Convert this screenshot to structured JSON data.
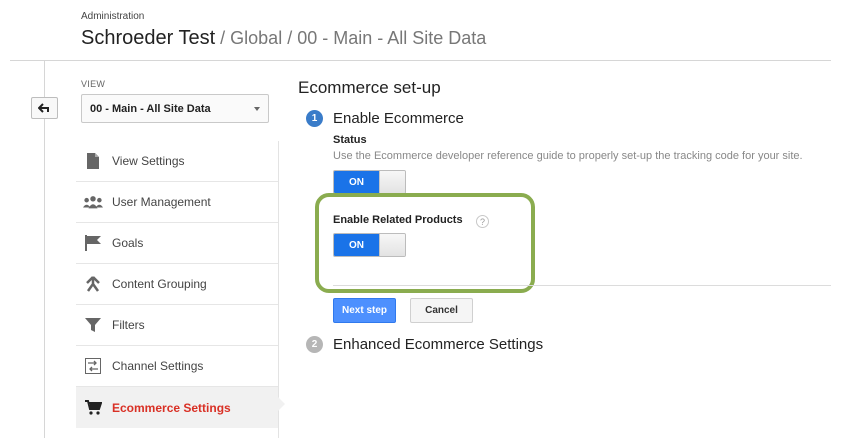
{
  "header": {
    "section_label": "Administration",
    "account_name": "Schroeder Test",
    "breadcrumb": " / Global / 00 - Main - All Site Data"
  },
  "view_selector": {
    "label": "VIEW",
    "selected": "00 - Main - All Site Data"
  },
  "sidebar": {
    "items": [
      {
        "label": "View Settings",
        "icon": "document-icon"
      },
      {
        "label": "User Management",
        "icon": "users-icon"
      },
      {
        "label": "Goals",
        "icon": "flag-icon"
      },
      {
        "label": "Content Grouping",
        "icon": "content-grouping-icon"
      },
      {
        "label": "Filters",
        "icon": "filter-icon"
      },
      {
        "label": "Channel Settings",
        "icon": "channel-settings-icon"
      },
      {
        "label": "Ecommerce Settings",
        "icon": "cart-icon",
        "active": true
      }
    ]
  },
  "main": {
    "title": "Ecommerce set-up",
    "step1": {
      "number": "1",
      "title": "Enable Ecommerce",
      "status_label": "Status",
      "status_description": "Use the Ecommerce developer reference guide to properly set-up the tracking code for your site.",
      "status_toggle": "ON",
      "related_label": "Enable Related Products",
      "related_help": "?",
      "related_toggle": "ON"
    },
    "buttons": {
      "next": "Next step",
      "cancel": "Cancel"
    },
    "step2": {
      "number": "2",
      "title": "Enhanced Ecommerce Settings"
    }
  },
  "colors": {
    "active_nav": "#d93025",
    "toggle_on": "#1a73e8",
    "next_button": "#4d90fe",
    "step_active": "#3a7cc9",
    "step_inactive": "#b6b6b6",
    "highlight": "#8aac4f"
  }
}
